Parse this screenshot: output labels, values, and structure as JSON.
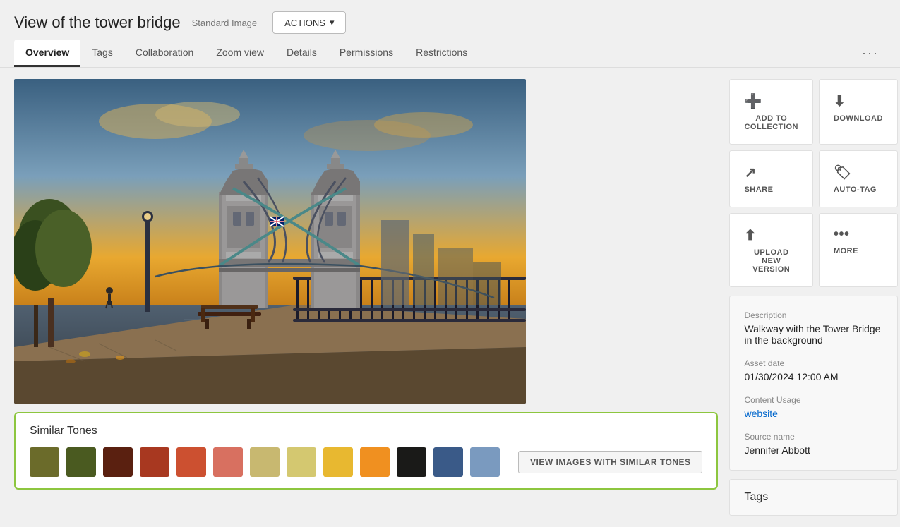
{
  "header": {
    "title": "View of the tower bridge",
    "badge": "Standard Image",
    "actions_label": "ACTIONS"
  },
  "tabs": [
    {
      "id": "overview",
      "label": "Overview",
      "active": true
    },
    {
      "id": "tags",
      "label": "Tags",
      "active": false
    },
    {
      "id": "collaboration",
      "label": "Collaboration",
      "active": false
    },
    {
      "id": "zoom-view",
      "label": "Zoom view",
      "active": false
    },
    {
      "id": "details",
      "label": "Details",
      "active": false
    },
    {
      "id": "permissions",
      "label": "Permissions",
      "active": false
    },
    {
      "id": "restrictions",
      "label": "Restrictions",
      "active": false
    }
  ],
  "actions": [
    {
      "id": "add-to-collection",
      "icon": "➕",
      "label": "ADD TO COLLECTION"
    },
    {
      "id": "download",
      "icon": "⬇",
      "label": "DOWNLOAD"
    },
    {
      "id": "share",
      "icon": "↗",
      "label": "SHARE"
    },
    {
      "id": "auto-tag",
      "icon": "🏷",
      "label": "AUTO-TAG"
    },
    {
      "id": "upload-new-version",
      "icon": "⬆",
      "label": "UPLOAD NEW VERSION"
    },
    {
      "id": "more",
      "icon": "•••",
      "label": "MORE"
    }
  ],
  "info": {
    "description_label": "Description",
    "description_value": "Walkway with the Tower Bridge in the background",
    "asset_date_label": "Asset date",
    "asset_date_value": "01/30/2024 12:00 AM",
    "content_usage_label": "Content Usage",
    "content_usage_value": "website",
    "source_name_label": "Source name",
    "source_name_value": "Jennifer Abbott"
  },
  "tags_section": {
    "title": "Tags"
  },
  "similar_tones": {
    "title": "Similar Tones",
    "view_btn_label": "VIEW IMAGES WITH SIMILAR TONES",
    "swatches": [
      "#6b6b2a",
      "#4a5a20",
      "#5a2010",
      "#a83820",
      "#cc5030",
      "#d87060",
      "#c8b870",
      "#d4c870",
      "#e8b830",
      "#f09020",
      "#1a1a18",
      "#3a5a88",
      "#7a9abf"
    ]
  }
}
